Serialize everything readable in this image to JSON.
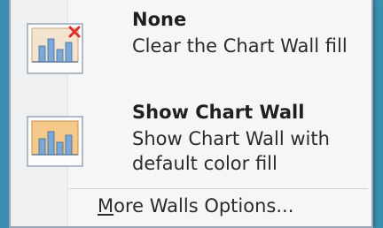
{
  "menu": {
    "items": [
      {
        "title": "None",
        "description": "Clear the Chart Wall fill",
        "icon": "chart-wall-none-icon"
      },
      {
        "title": "Show Chart Wall",
        "description": "Show Chart Wall with default color fill",
        "icon": "chart-wall-show-icon"
      }
    ],
    "more_options": {
      "mnemonic": "M",
      "rest": "ore Walls Options..."
    }
  },
  "colors": {
    "background": "#2e7f9c",
    "menu_background": "#f6f6f6",
    "icon_wall_fill": "#f5c98a",
    "icon_bars": "#7aa8d8",
    "delete_x": "#e0302a"
  }
}
